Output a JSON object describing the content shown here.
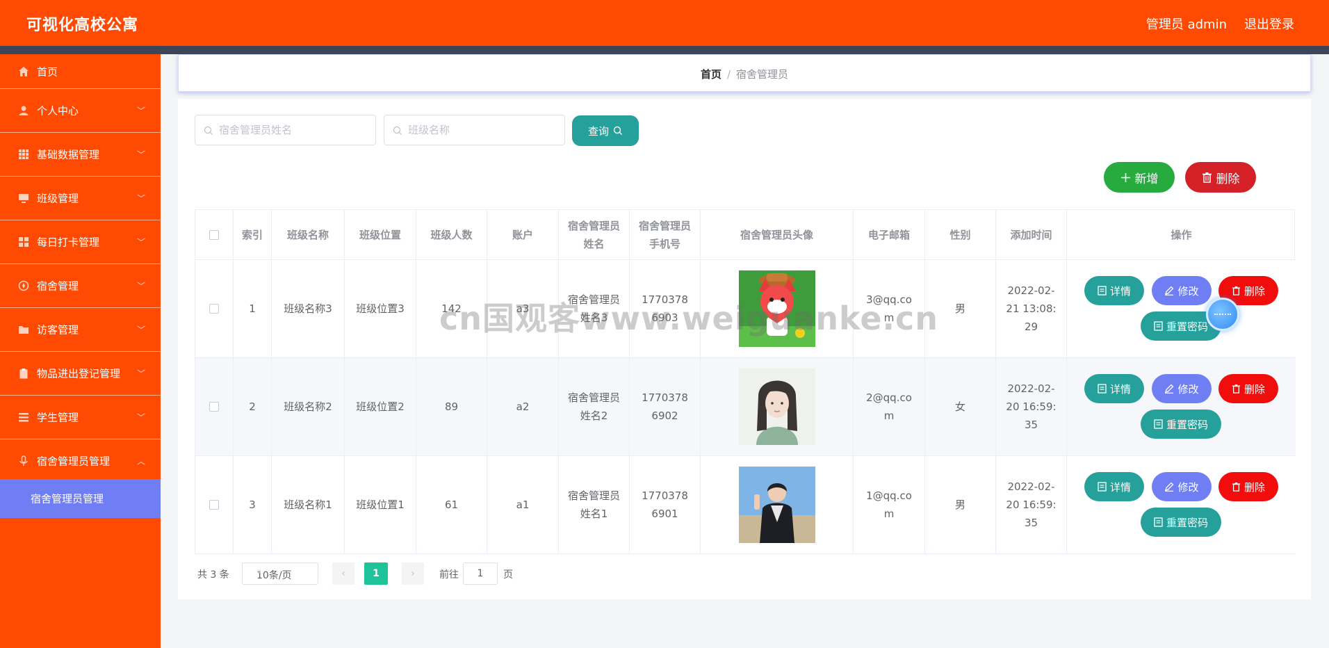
{
  "header": {
    "app_title": "可视化高校公寓",
    "user_label": "管理员 admin",
    "logout_label": "退出登录"
  },
  "sidebar": {
    "items": [
      {
        "label": "首页",
        "icon": "home-icon"
      },
      {
        "label": "个人中心",
        "icon": "user-icon"
      },
      {
        "label": "基础数据管理",
        "icon": "grid-icon"
      },
      {
        "label": "班级管理",
        "icon": "monitor-icon"
      },
      {
        "label": "每日打卡管理",
        "icon": "apps-icon"
      },
      {
        "label": "宿舍管理",
        "icon": "compass-icon"
      },
      {
        "label": "访客管理",
        "icon": "folder-icon"
      },
      {
        "label": "物品进出登记管理",
        "icon": "clipboard-icon"
      },
      {
        "label": "学生管理",
        "icon": "list-icon"
      },
      {
        "label": "宿舍管理员管理",
        "icon": "microphone-icon"
      }
    ],
    "active_sub": "宿舍管理员管理"
  },
  "breadcrumb": {
    "home": "首页",
    "separator": "/",
    "current": "宿舍管理员"
  },
  "search": {
    "name_placeholder": "宿舍管理员姓名",
    "class_placeholder": "班级名称",
    "query_label": "查询"
  },
  "toolbar": {
    "add_label": "新增",
    "delete_label": "删除"
  },
  "table": {
    "headers": {
      "index": "索引",
      "class_name": "班级名称",
      "class_location": "班级位置",
      "class_count": "班级人数",
      "account": "账户",
      "manager_name": "宿舍管理员姓名",
      "manager_phone": "宿舍管理员手机号",
      "manager_avatar": "宿舍管理员头像",
      "email": "电子邮箱",
      "gender": "性别",
      "created_at": "添加时间",
      "actions": "操作"
    },
    "rows": [
      {
        "index": "1",
        "class_name": "班级名称3",
        "class_location": "班级位置3",
        "class_count": "142",
        "account": "a3",
        "manager_name": "宿舍管理员姓名3",
        "manager_phone": "17703786903",
        "email": "3@qq.com",
        "gender": "男",
        "created_at": "2022-02-21 13:08:29",
        "avatar_desc": "cartoon-fox-avatar"
      },
      {
        "index": "2",
        "class_name": "班级名称2",
        "class_location": "班级位置2",
        "class_count": "89",
        "account": "a2",
        "manager_name": "宿舍管理员姓名2",
        "manager_phone": "17703786902",
        "email": "2@qq.com",
        "gender": "女",
        "created_at": "2022-02-20 16:59:35",
        "avatar_desc": "girl-portrait-avatar"
      },
      {
        "index": "3",
        "class_name": "班级名称1",
        "class_location": "班级位置1",
        "class_count": "61",
        "account": "a1",
        "manager_name": "宿舍管理员姓名1",
        "manager_phone": "17703786901",
        "email": "1@qq.com",
        "gender": "男",
        "created_at": "2022-02-20 16:59:35",
        "avatar_desc": "boy-photo-avatar"
      }
    ],
    "action_labels": {
      "detail": "详情",
      "edit": "修改",
      "delete": "删除",
      "reset": "重置密码"
    }
  },
  "pagination": {
    "total": "共 3 条",
    "page_size": "10条/页",
    "current_page": "1",
    "goto_label": "前往",
    "goto_value": "1",
    "page_unit": "页"
  },
  "watermark": "cn国观客www.weiguanke.cn",
  "colors": {
    "brand": "#ff4a04",
    "topline": "#3d4558",
    "teal": "#26a09a",
    "indigo": "#6f7ef2",
    "red": "#f20d0d",
    "green": "#27ab3f"
  }
}
